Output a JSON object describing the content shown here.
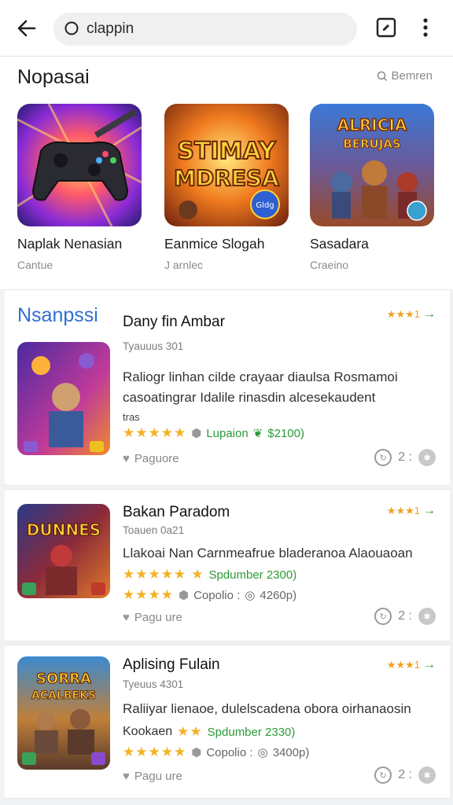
{
  "search": {
    "value": "clappin"
  },
  "featured": {
    "title": "Nopasai",
    "link": "Bemren",
    "items": [
      {
        "name": "Naplak Nenasian",
        "sub": "Cantue"
      },
      {
        "name": "Eanmice Slogah",
        "sub": "J arnlec",
        "art_text": "STIMAY\nMDRESA",
        "badge": "Gldg"
      },
      {
        "name": "Sasadara",
        "sub": "Craeino",
        "art_text": "ALRICIA\nBERUJAS"
      }
    ]
  },
  "list": {
    "label": "Nsanpssi",
    "apps": [
      {
        "title": "Dany fin Ambar",
        "sub": "Tyauuus 301",
        "desc": "Raliogr linhan cilde crayaar diaulsa Rosmamoi casoatingrar Idalile rinasdin alcesekaudent",
        "desc_extra": "tras",
        "corner": "★★★1",
        "rating_rows": [
          {
            "stars": "★★★★★",
            "icon": "gray-dot",
            "label": "Lupaion",
            "icon2": "green-leaf",
            "price": "$2100)"
          }
        ],
        "footer": "Paguore",
        "count": "2 :"
      },
      {
        "title": "Bakan Paradom",
        "sub": "Toauen 0a21",
        "art_text": "DUNNES",
        "desc": "Llakoai Nan Carnmeafrue bladeranoa Alaouaoan",
        "corner": "★★★1",
        "rating_rows": [
          {
            "stars": "★★★★★",
            "icon": "gold-star",
            "label": "Spdumber 2300)"
          },
          {
            "stars": "★★★★",
            "icon": "gray-dot",
            "label": "Copolio :",
            "icon2": "gray-circle",
            "price": "4260p)"
          }
        ],
        "footer": "Pagu ure",
        "count": "2 :"
      },
      {
        "title": "Aplising Fulain",
        "sub": "Tyeuus 4301",
        "art_text": "SORRA\nACALBEKS",
        "desc": "Raliiyar lienaoe, dulelscadena obora oirhanaosin",
        "desc_lead": "Kookaen",
        "desc_lead_stars": "★★",
        "desc_lead_label": "Spdumber 2330)",
        "corner": "★★★1",
        "rating_rows": [
          {
            "stars": "★★★★★",
            "icon": "gray-dot",
            "label": "Copolio :",
            "icon2": "gray-circle",
            "price": "3400p)"
          }
        ],
        "footer": "Pagu ure",
        "count": "2 :"
      }
    ]
  },
  "colors": {
    "accent_blue": "#2f6fd3",
    "green": "#2b9b37",
    "star": "#f4b222"
  }
}
